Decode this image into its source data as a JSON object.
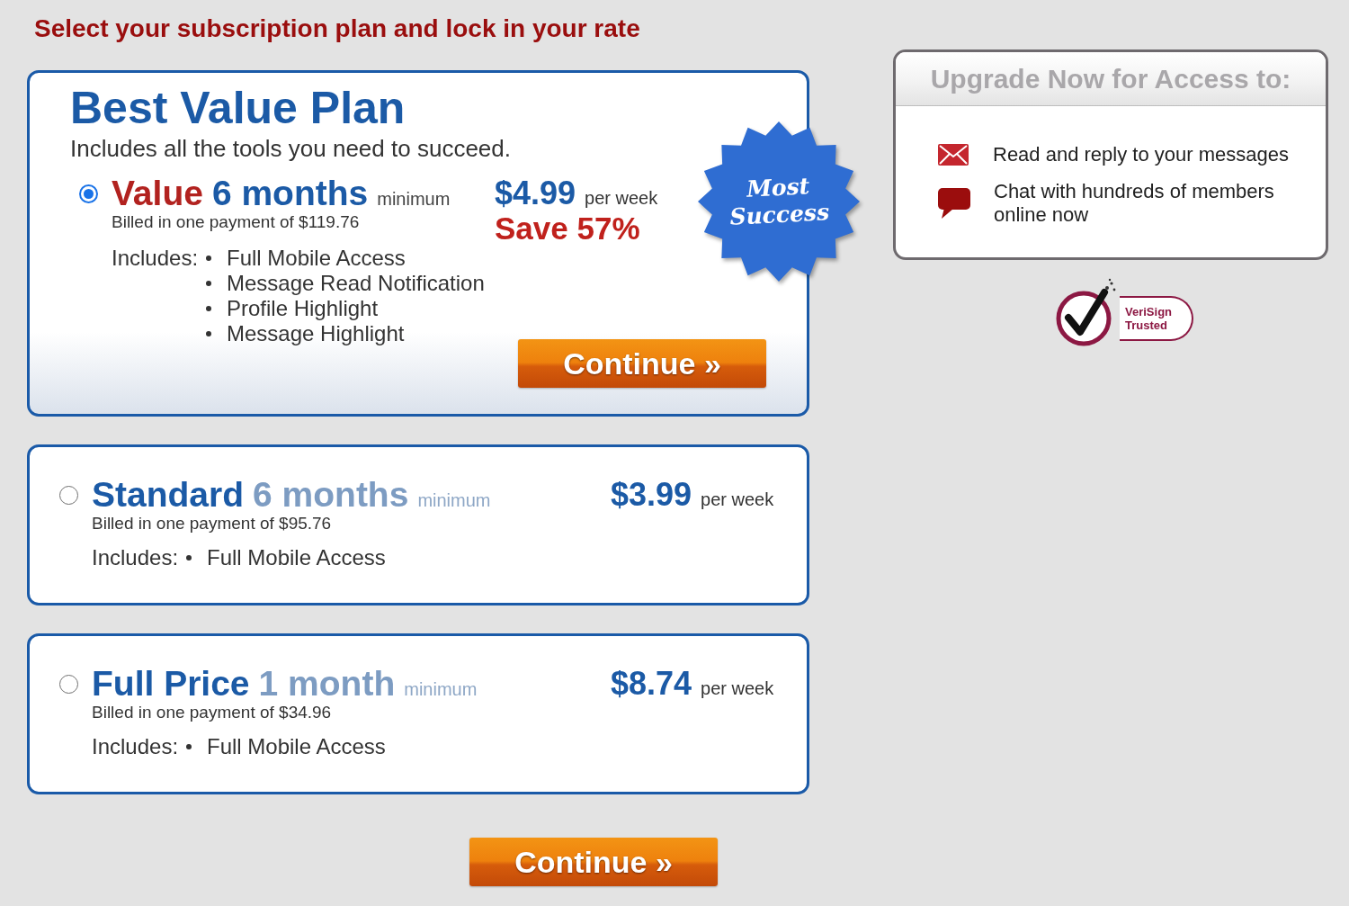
{
  "heading": "Select your subscription plan and lock in your rate",
  "plans": [
    {
      "kind": "featured",
      "selected": true,
      "title": "Best Value Plan",
      "subtitle": "Includes all the tools you need to succeed.",
      "name": "Value",
      "term": "6 months",
      "minimum": "minimum",
      "billing": "Billed in one payment of $119.76",
      "price": "$4.99",
      "price_unit": "per week",
      "savings": "Save 57%",
      "includes_label": "Includes:",
      "features": [
        "Full Mobile Access",
        "Message Read Notification",
        "Profile Highlight",
        "Message Highlight"
      ],
      "badge": "Most Success",
      "button": "Continue »"
    },
    {
      "kind": "standard",
      "selected": false,
      "name": "Standard",
      "term": "6 months",
      "minimum": "minimum",
      "billing": "Billed in one payment of $95.76",
      "price": "$3.99",
      "price_unit": "per week",
      "includes_label": "Includes:",
      "features": [
        "Full Mobile Access"
      ]
    },
    {
      "kind": "standard",
      "selected": false,
      "name": "Full Price",
      "term": "1 month",
      "minimum": "minimum",
      "billing": "Billed in one payment of $34.96",
      "price": "$8.74",
      "price_unit": "per week",
      "includes_label": "Includes:",
      "features": [
        "Full Mobile Access"
      ]
    }
  ],
  "continue_button": "Continue »",
  "benefits": {
    "title": "Upgrade Now for Access to:",
    "items": [
      {
        "kind": "message",
        "text": "Read and reply to your messages"
      },
      {
        "kind": "chat",
        "text": "Chat with hundreds of members online now"
      }
    ]
  },
  "trust_seal": "VeriSign Trusted"
}
